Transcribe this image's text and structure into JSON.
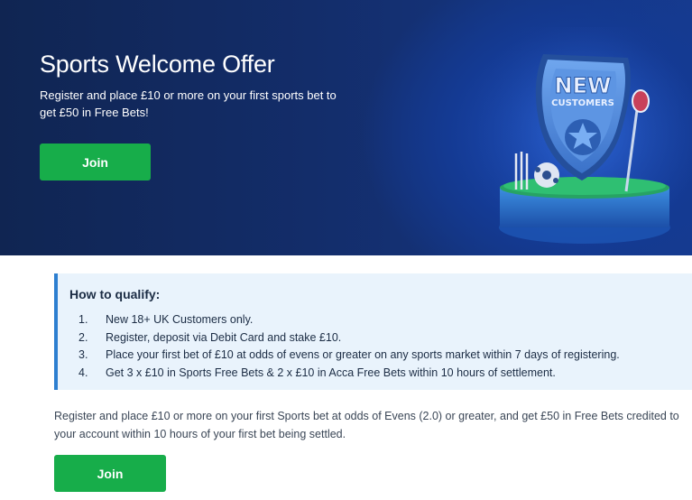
{
  "hero": {
    "title": "Sports Welcome Offer",
    "description": "Register and place £10 or more on your first sports bet to get £50 in Free Bets!",
    "join_label": "Join",
    "badge_line1": "NEW",
    "badge_line2": "CUSTOMERS"
  },
  "qualify": {
    "title": "How to qualify:",
    "steps": [
      {
        "num": "1.",
        "text": "New 18+ UK Customers only."
      },
      {
        "num": "2.",
        "text": "Register, deposit via Debit Card and stake £10."
      },
      {
        "num": "3.",
        "text": "Place your first bet of £10 at odds of evens or greater on any sports market within 7 days of registering."
      },
      {
        "num": "4.",
        "text": "Get 3 x £10 in Sports Free Bets & 2 x £10 in Acca Free Bets within 10 hours of settlement."
      }
    ]
  },
  "terms": {
    "text": "Register and place £10 or more on your first Sports bet at odds of Evens (2.0) or greater, and get £50 in Free Bets credited to your account within 10 hours of your first bet being settled."
  },
  "bottom": {
    "join_label": "Join"
  },
  "colors": {
    "hero_dark": "#102552",
    "hero_accent": "#1d4fbd",
    "join_green": "#17ad4a",
    "qualify_bg": "#e9f3fc",
    "qualify_border": "#2d7fd0"
  }
}
